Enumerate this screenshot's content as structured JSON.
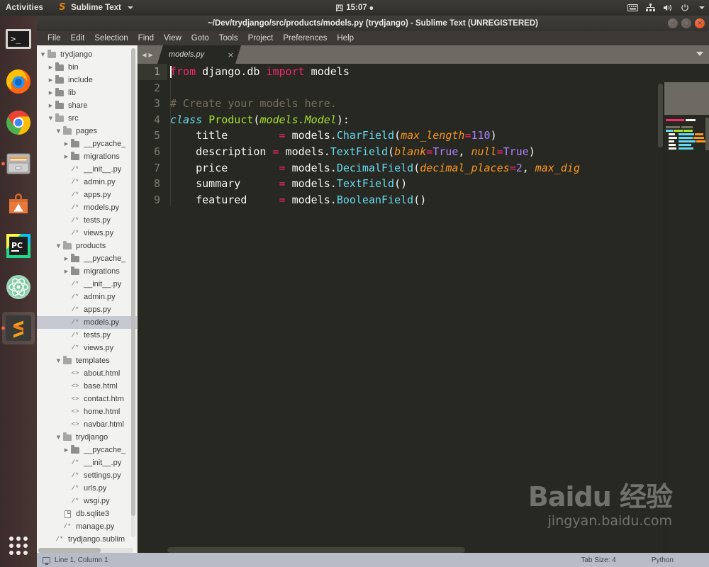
{
  "topbar": {
    "activities": "Activities",
    "app_name": "Sublime Text",
    "app_icon": "sublime-text-icon",
    "clock_glyph": "四",
    "clock": "15:07",
    "tray_icons": [
      "keyboard-icon",
      "network-icon",
      "volume-icon",
      "power-icon",
      "chevron-down-icon"
    ]
  },
  "launcher": {
    "items": [
      {
        "name": "terminal-icon",
        "label": "Terminal",
        "running": false
      },
      {
        "name": "firefox-icon",
        "label": "Firefox",
        "running": false
      },
      {
        "name": "chrome-icon",
        "label": "Google Chrome",
        "running": false
      },
      {
        "name": "files-icon",
        "label": "Files",
        "running": true
      },
      {
        "name": "ubuntu-software-icon",
        "label": "Ubuntu Software",
        "running": false
      },
      {
        "name": "pycharm-icon",
        "label": "PyCharm",
        "running": false
      },
      {
        "name": "atom-icon",
        "label": "Atom",
        "running": false
      },
      {
        "name": "sublime-text-icon",
        "label": "Sublime Text",
        "running": true
      }
    ],
    "show_apps_label": "Show Applications"
  },
  "window": {
    "title": "~/Dev/trydjango/src/products/models.py (trydjango) - Sublime Text (UNREGISTERED)",
    "buttons": {
      "minimize": "−",
      "maximize": "□",
      "close": "×"
    }
  },
  "menubar": {
    "items": [
      "File",
      "Edit",
      "Selection",
      "Find",
      "View",
      "Goto",
      "Tools",
      "Project",
      "Preferences",
      "Help"
    ]
  },
  "sidebar": {
    "rows": [
      {
        "label": "trydjango",
        "indent": 0,
        "arrow": "down",
        "icon": "folder-open-icon",
        "selected": false
      },
      {
        "label": "bin",
        "indent": 1,
        "arrow": "right",
        "icon": "folder-icon",
        "selected": false
      },
      {
        "label": "include",
        "indent": 1,
        "arrow": "right",
        "icon": "folder-icon",
        "selected": false
      },
      {
        "label": "lib",
        "indent": 1,
        "arrow": "right",
        "icon": "folder-icon",
        "selected": false
      },
      {
        "label": "share",
        "indent": 1,
        "arrow": "right",
        "icon": "folder-icon",
        "selected": false
      },
      {
        "label": "src",
        "indent": 1,
        "arrow": "down",
        "icon": "folder-open-icon",
        "selected": false
      },
      {
        "label": "pages",
        "indent": 2,
        "arrow": "down",
        "icon": "folder-open-icon",
        "selected": false
      },
      {
        "label": "__pycache_",
        "indent": 3,
        "arrow": "right",
        "icon": "folder-icon",
        "selected": false
      },
      {
        "label": "migrations",
        "indent": 3,
        "arrow": "right",
        "icon": "folder-icon",
        "selected": false
      },
      {
        "label": "__init__.py",
        "indent": 3,
        "arrow": "none",
        "icon": "python-file-icon",
        "selected": false
      },
      {
        "label": "admin.py",
        "indent": 3,
        "arrow": "none",
        "icon": "python-file-icon",
        "selected": false
      },
      {
        "label": "apps.py",
        "indent": 3,
        "arrow": "none",
        "icon": "python-file-icon",
        "selected": false
      },
      {
        "label": "models.py",
        "indent": 3,
        "arrow": "none",
        "icon": "python-file-icon",
        "selected": false
      },
      {
        "label": "tests.py",
        "indent": 3,
        "arrow": "none",
        "icon": "python-file-icon",
        "selected": false
      },
      {
        "label": "views.py",
        "indent": 3,
        "arrow": "none",
        "icon": "python-file-icon",
        "selected": false
      },
      {
        "label": "products",
        "indent": 2,
        "arrow": "down",
        "icon": "folder-open-icon",
        "selected": false
      },
      {
        "label": "__pycache_",
        "indent": 3,
        "arrow": "right",
        "icon": "folder-icon",
        "selected": false
      },
      {
        "label": "migrations",
        "indent": 3,
        "arrow": "right",
        "icon": "folder-icon",
        "selected": false
      },
      {
        "label": "__init__.py",
        "indent": 3,
        "arrow": "none",
        "icon": "python-file-icon",
        "selected": false
      },
      {
        "label": "admin.py",
        "indent": 3,
        "arrow": "none",
        "icon": "python-file-icon",
        "selected": false
      },
      {
        "label": "apps.py",
        "indent": 3,
        "arrow": "none",
        "icon": "python-file-icon",
        "selected": false
      },
      {
        "label": "models.py",
        "indent": 3,
        "arrow": "none",
        "icon": "python-file-icon",
        "selected": true
      },
      {
        "label": "tests.py",
        "indent": 3,
        "arrow": "none",
        "icon": "python-file-icon",
        "selected": false
      },
      {
        "label": "views.py",
        "indent": 3,
        "arrow": "none",
        "icon": "python-file-icon",
        "selected": false
      },
      {
        "label": "templates",
        "indent": 2,
        "arrow": "down",
        "icon": "folder-open-icon",
        "selected": false
      },
      {
        "label": "about.html",
        "indent": 3,
        "arrow": "none",
        "icon": "html-file-icon",
        "selected": false
      },
      {
        "label": "base.html",
        "indent": 3,
        "arrow": "none",
        "icon": "html-file-icon",
        "selected": false
      },
      {
        "label": "contact.htm",
        "indent": 3,
        "arrow": "none",
        "icon": "html-file-icon",
        "selected": false
      },
      {
        "label": "home.html",
        "indent": 3,
        "arrow": "none",
        "icon": "html-file-icon",
        "selected": false
      },
      {
        "label": "navbar.html",
        "indent": 3,
        "arrow": "none",
        "icon": "html-file-icon",
        "selected": false
      },
      {
        "label": "trydjango",
        "indent": 2,
        "arrow": "down",
        "icon": "folder-open-icon",
        "selected": false
      },
      {
        "label": "__pycache_",
        "indent": 3,
        "arrow": "right",
        "icon": "folder-icon",
        "selected": false
      },
      {
        "label": "__init__.py",
        "indent": 3,
        "arrow": "none",
        "icon": "python-file-icon",
        "selected": false
      },
      {
        "label": "settings.py",
        "indent": 3,
        "arrow": "none",
        "icon": "python-file-icon",
        "selected": false
      },
      {
        "label": "urls.py",
        "indent": 3,
        "arrow": "none",
        "icon": "python-file-icon",
        "selected": false
      },
      {
        "label": "wsgi.py",
        "indent": 3,
        "arrow": "none",
        "icon": "python-file-icon",
        "selected": false
      },
      {
        "label": "db.sqlite3",
        "indent": 2,
        "arrow": "none",
        "icon": "file-icon",
        "selected": false
      },
      {
        "label": "manage.py",
        "indent": 2,
        "arrow": "none",
        "icon": "python-file-icon",
        "selected": false
      },
      {
        "label": "trydjango.sublim",
        "indent": 1,
        "arrow": "none",
        "icon": "python-file-icon",
        "selected": false
      }
    ]
  },
  "tabs": {
    "nav_prev": "◀",
    "nav_next": "▶",
    "items": [
      {
        "label": "models.py",
        "close": "×",
        "active": true
      }
    ]
  },
  "editor": {
    "line_numbers": [
      "1",
      "2",
      "3",
      "4",
      "5",
      "6",
      "7",
      "8",
      "9"
    ],
    "active_line": 1,
    "lines": [
      {
        "n": 1,
        "tokens": [
          {
            "t": "from",
            "c": "t-kw"
          },
          {
            "t": " django.db ",
            "c": "t-plain"
          },
          {
            "t": "import",
            "c": "t-kw"
          },
          {
            "t": " models",
            "c": "t-plain"
          }
        ]
      },
      {
        "n": 2,
        "tokens": []
      },
      {
        "n": 3,
        "tokens": [
          {
            "t": "# Create your models here.",
            "c": "t-com"
          }
        ]
      },
      {
        "n": 4,
        "tokens": [
          {
            "t": "class",
            "c": "t-kw2"
          },
          {
            "t": " ",
            "c": "t-plain"
          },
          {
            "t": "Product",
            "c": "t-cls"
          },
          {
            "t": "(",
            "c": "t-plain"
          },
          {
            "t": "models.Model",
            "c": "t-italic-cls"
          },
          {
            "t": "):",
            "c": "t-plain"
          }
        ]
      },
      {
        "n": 5,
        "tokens": [
          {
            "t": "    title        ",
            "c": "t-plain"
          },
          {
            "t": "=",
            "c": "t-kw"
          },
          {
            "t": " models.",
            "c": "t-plain"
          },
          {
            "t": "CharField",
            "c": "t-fn"
          },
          {
            "t": "(",
            "c": "t-plain"
          },
          {
            "t": "max_length",
            "c": "t-param"
          },
          {
            "t": "=",
            "c": "t-kw"
          },
          {
            "t": "110",
            "c": "t-num"
          },
          {
            "t": ")",
            "c": "t-plain"
          }
        ]
      },
      {
        "n": 6,
        "tokens": [
          {
            "t": "    description ",
            "c": "t-plain"
          },
          {
            "t": "=",
            "c": "t-kw"
          },
          {
            "t": " models.",
            "c": "t-plain"
          },
          {
            "t": "TextField",
            "c": "t-fn"
          },
          {
            "t": "(",
            "c": "t-plain"
          },
          {
            "t": "blank",
            "c": "t-param"
          },
          {
            "t": "=",
            "c": "t-kw"
          },
          {
            "t": "True",
            "c": "t-const"
          },
          {
            "t": ", ",
            "c": "t-plain"
          },
          {
            "t": "null",
            "c": "t-param"
          },
          {
            "t": "=",
            "c": "t-kw"
          },
          {
            "t": "True",
            "c": "t-const"
          },
          {
            "t": ")",
            "c": "t-plain"
          }
        ]
      },
      {
        "n": 7,
        "tokens": [
          {
            "t": "    price        ",
            "c": "t-plain"
          },
          {
            "t": "=",
            "c": "t-kw"
          },
          {
            "t": " models.",
            "c": "t-plain"
          },
          {
            "t": "DecimalField",
            "c": "t-fn"
          },
          {
            "t": "(",
            "c": "t-plain"
          },
          {
            "t": "decimal_places",
            "c": "t-param"
          },
          {
            "t": "=",
            "c": "t-kw"
          },
          {
            "t": "2",
            "c": "t-num"
          },
          {
            "t": ", ",
            "c": "t-plain"
          },
          {
            "t": "max_dig",
            "c": "t-param"
          }
        ]
      },
      {
        "n": 8,
        "tokens": [
          {
            "t": "    summary      ",
            "c": "t-plain"
          },
          {
            "t": "=",
            "c": "t-kw"
          },
          {
            "t": " models.",
            "c": "t-plain"
          },
          {
            "t": "TextField",
            "c": "t-fn"
          },
          {
            "t": "()",
            "c": "t-plain"
          }
        ]
      },
      {
        "n": 9,
        "tokens": [
          {
            "t": "    featured     ",
            "c": "t-plain"
          },
          {
            "t": "=",
            "c": "t-kw"
          },
          {
            "t": " models.",
            "c": "t-plain"
          },
          {
            "t": "BooleanField",
            "c": "t-fn"
          },
          {
            "t": "()",
            "c": "t-plain"
          }
        ]
      }
    ]
  },
  "statusbar": {
    "position": "Line 1, Column 1",
    "tab_size": "Tab Size: 4",
    "syntax": "Python"
  },
  "watermark": {
    "main": "Baidu 经验",
    "sub": "jingyan.baidu.com"
  },
  "colors": {
    "editor_bg": "#272822",
    "keyword": "#f92672",
    "function": "#66d9ef",
    "class": "#a6e22e",
    "param": "#fd971f",
    "number": "#ae81ff",
    "comment": "#75715e",
    "accent": "#e8820e"
  }
}
